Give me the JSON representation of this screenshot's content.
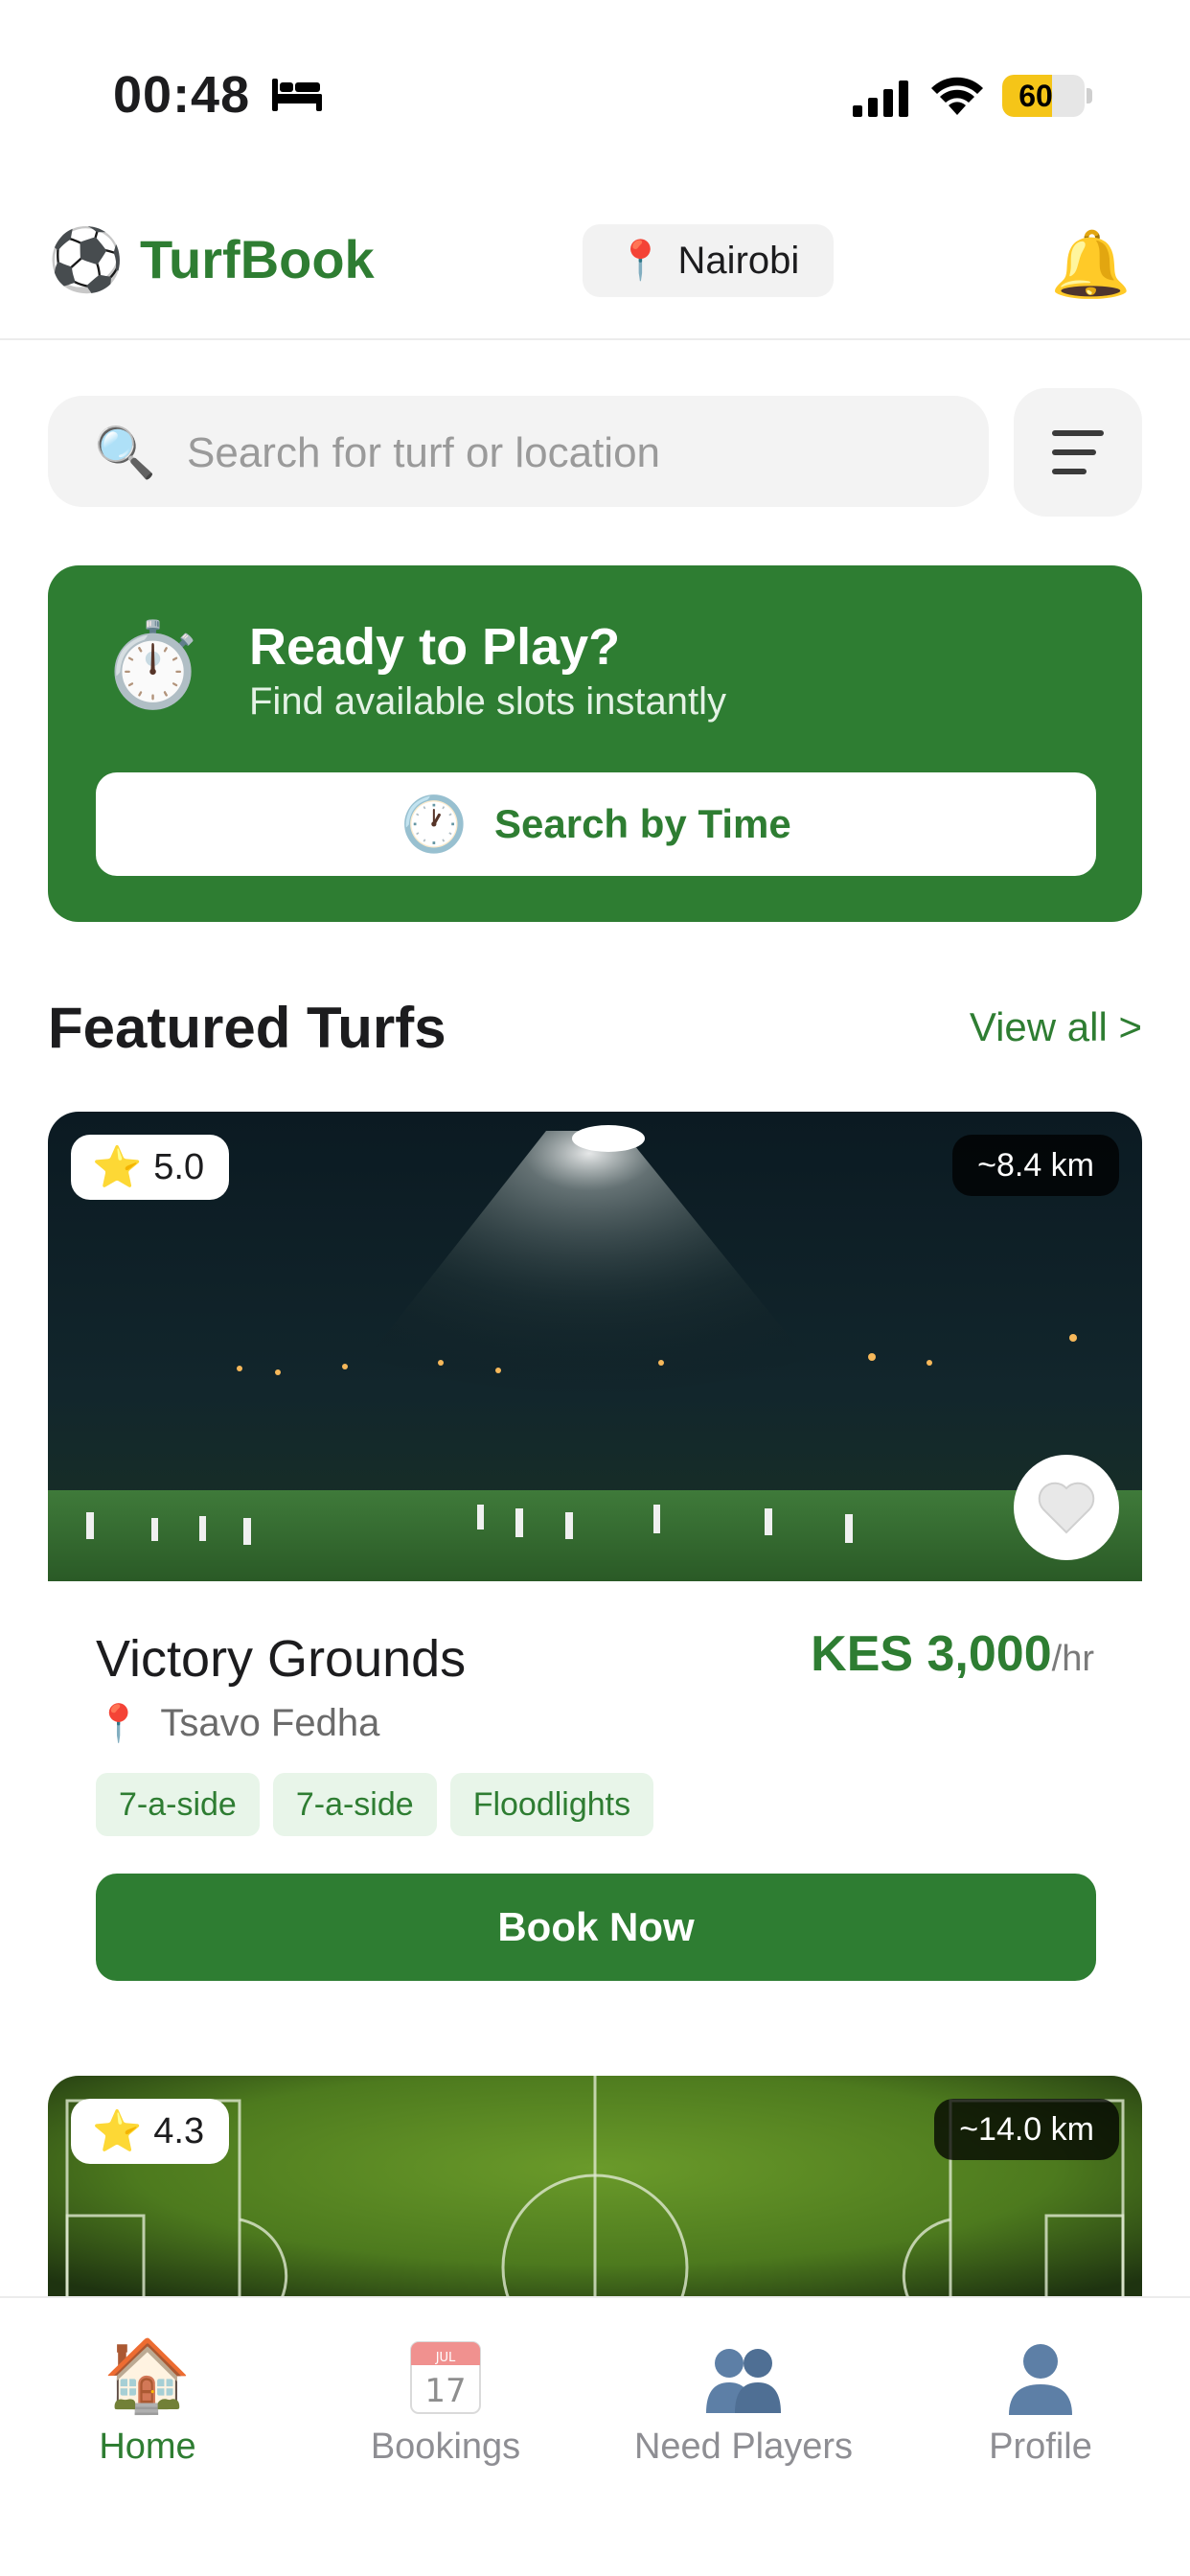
{
  "status_bar": {
    "time": "00:48",
    "battery": "60",
    "battery_level": 0.6
  },
  "header": {
    "app_name": "TurfBook",
    "location": "Nairobi"
  },
  "search": {
    "placeholder": "Search for turf or location"
  },
  "promo": {
    "title": "Ready to Play?",
    "subtitle": "Find available slots instantly",
    "button_label": "Search by Time"
  },
  "featured": {
    "title": "Featured Turfs",
    "view_all": "View all >"
  },
  "turfs": [
    {
      "rating": "5.0",
      "distance": "~8.4 km",
      "name": "Victory Grounds",
      "price": "KES 3,000",
      "price_unit": "/hr",
      "location": "Tsavo Fedha",
      "tags": [
        "7-a-side",
        "7-a-side",
        "Floodlights"
      ],
      "book_label": "Book Now"
    },
    {
      "rating": "4.3",
      "distance": "~14.0 km"
    }
  ],
  "tabs": [
    {
      "label": "Home",
      "icon": "house-icon",
      "active": true
    },
    {
      "label": "Bookings",
      "icon": "calendar-icon",
      "active": false
    },
    {
      "label": "Need Players",
      "icon": "users-icon",
      "active": false
    },
    {
      "label": "Profile",
      "icon": "user-icon",
      "active": false
    }
  ],
  "calendar_icon": {
    "month": "JUL",
    "day": "17"
  },
  "colors": {
    "brand_green": "#2e7d32",
    "tag_bg": "#e8f5e9",
    "battery_yellow": "#f5c518"
  }
}
